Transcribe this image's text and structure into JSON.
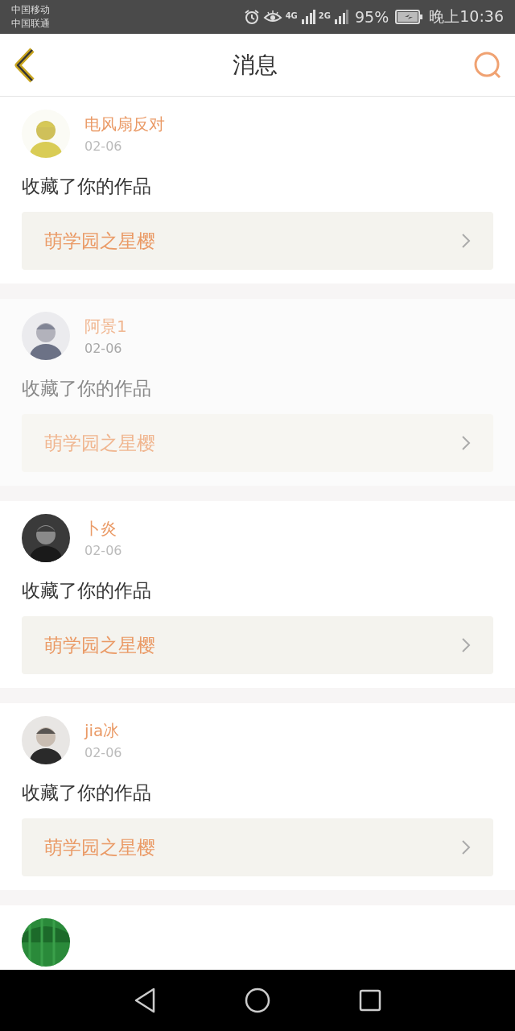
{
  "status_bar": {
    "carriers": [
      "中国移动",
      "中国联通"
    ],
    "network_1": "4G",
    "network_2": "2G",
    "battery": "95%",
    "time": "晚上10:36"
  },
  "header": {
    "title": "消息"
  },
  "messages": [
    {
      "name": "电风扇反对",
      "date": "02-06",
      "action": "收藏了你的作品",
      "work": "萌学园之星樱",
      "pressed": false
    },
    {
      "name": "阿景1",
      "date": "02-06",
      "action": "收藏了你的作品",
      "work": "萌学园之星樱",
      "pressed": true
    },
    {
      "name": "卜炎",
      "date": "02-06",
      "action": "收藏了你的作品",
      "work": "萌学园之星樱",
      "pressed": false
    },
    {
      "name": "jia冰",
      "date": "02-06",
      "action": "收藏了你的作品",
      "work": "萌学园之星樱",
      "pressed": false
    }
  ]
}
